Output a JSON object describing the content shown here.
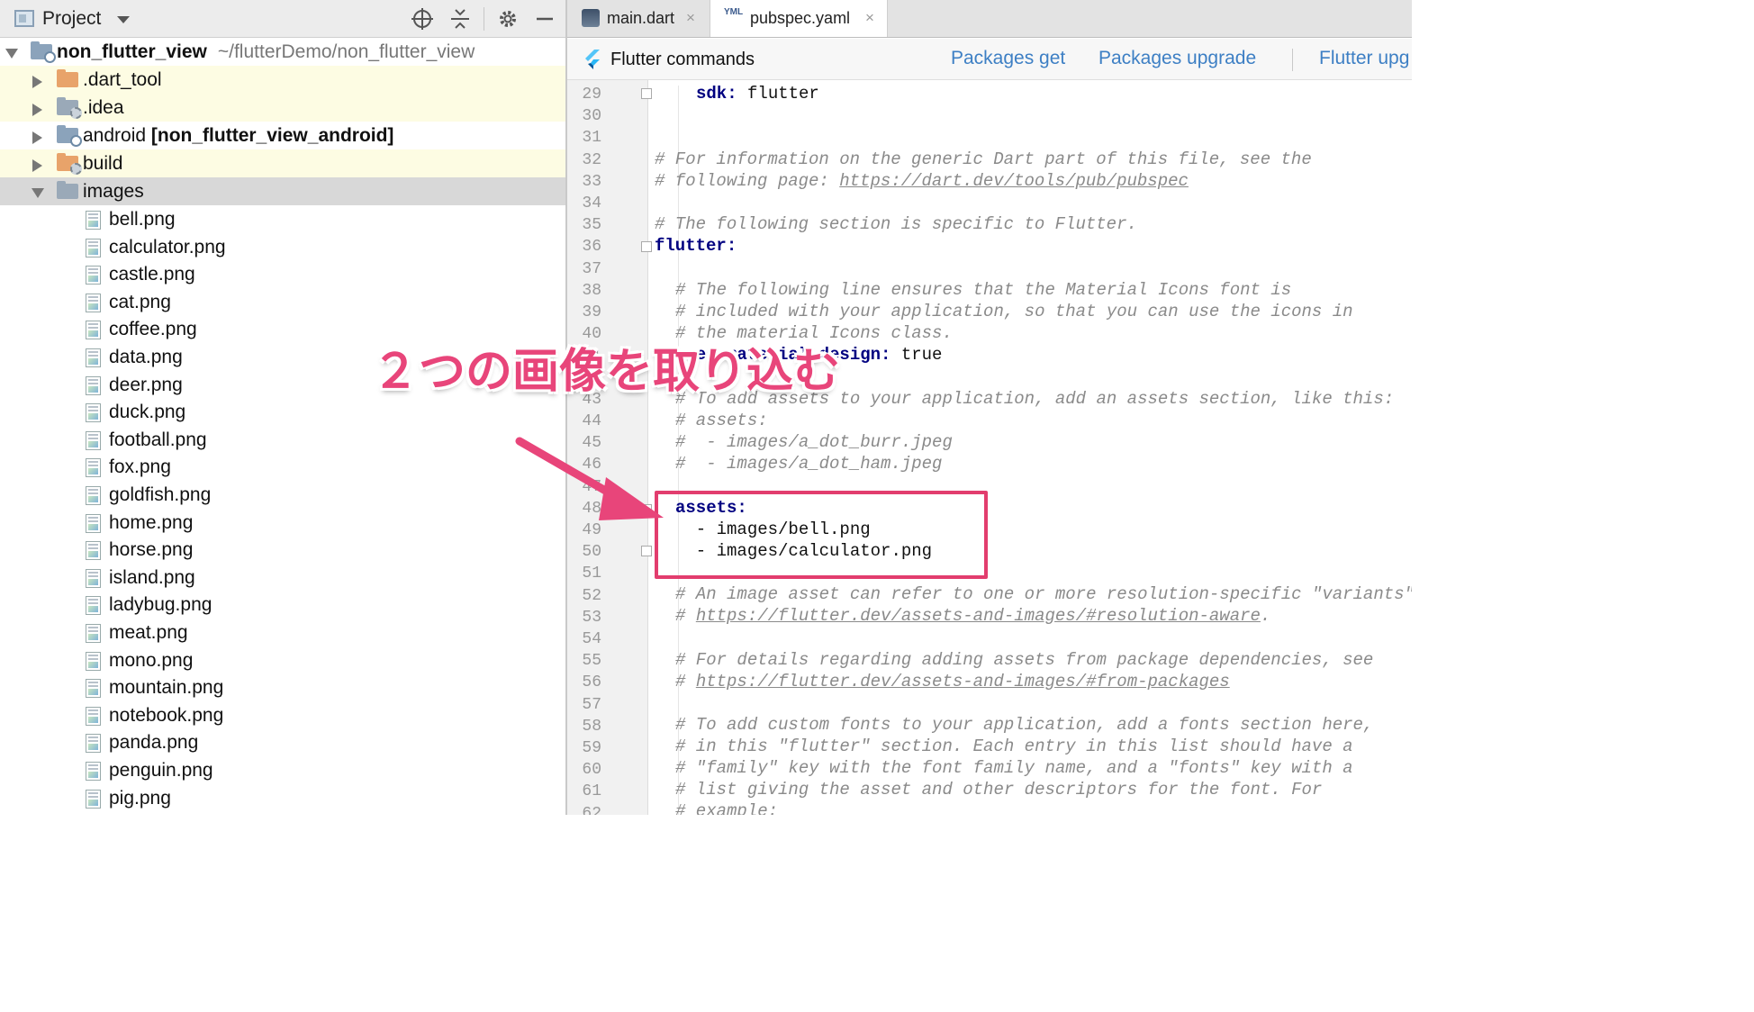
{
  "project_panel": {
    "title": "Project",
    "root": {
      "name": "non_flutter_view",
      "path": "~/flutterDemo/non_flutter_view"
    },
    "folders": [
      {
        "name": ".dart_tool",
        "bold_suffix": ""
      },
      {
        "name": ".idea",
        "bold_suffix": ""
      },
      {
        "name": "android",
        "bold_suffix": "[non_flutter_view_android]"
      },
      {
        "name": "build",
        "bold_suffix": ""
      },
      {
        "name": "images",
        "bold_suffix": ""
      }
    ],
    "files": [
      "bell.png",
      "calculator.png",
      "castle.png",
      "cat.png",
      "coffee.png",
      "data.png",
      "deer.png",
      "duck.png",
      "football.png",
      "fox.png",
      "goldfish.png",
      "home.png",
      "horse.png",
      "island.png",
      "ladybug.png",
      "meat.png",
      "mono.png",
      "mountain.png",
      "notebook.png",
      "panda.png",
      "penguin.png",
      "pig.png"
    ],
    "icons": [
      "crosshair-icon",
      "collapse-all-icon",
      "gear-icon",
      "minimize-icon"
    ]
  },
  "editor": {
    "tabs": [
      {
        "label": "main.dart",
        "active": false
      },
      {
        "label": "pubspec.yaml",
        "active": true
      }
    ],
    "tab_close": "×",
    "yml_badge": "YML",
    "flutter_commands": {
      "title": "Flutter commands",
      "actions": [
        "Packages get",
        "Packages upgrade",
        "Flutter upg"
      ]
    },
    "line_numbers": [
      "29",
      "30",
      "31",
      "32",
      "33",
      "34",
      "35",
      "36",
      "37",
      "38",
      "39",
      "40",
      "41",
      "42",
      "43",
      "44",
      "45",
      "46",
      "47",
      "48",
      "49",
      "50",
      "51",
      "52",
      "53",
      "54",
      "55",
      "56",
      "57",
      "58",
      "59",
      "60",
      "61",
      "62"
    ],
    "code": {
      "l29_key": "sdk:",
      "l29_val": " flutter",
      "l32": "# For information on the generic Dart part of this file, see the",
      "l33_pre": "# following page: ",
      "l33_link": "https://dart.dev/tools/pub/pubspec",
      "l35": "# The following section is specific to Flutter.",
      "l36_key": "flutter:",
      "l38": "# The following line ensures that the Material Icons font is",
      "l39": "# included with your application, so that you can use the icons in",
      "l40": "# the material Icons class.",
      "l41_key": "uses-material-design:",
      "l41_val": " true",
      "l43": "# To add assets to your application, add an assets section, like this:",
      "l44": "# assets:",
      "l45": "#  - images/a_dot_burr.jpeg",
      "l46": "#  - images/a_dot_ham.jpeg",
      "l48_key": "assets:",
      "l49": "  - images/bell.png",
      "l50": "  - images/calculator.png",
      "l52": "# An image asset can refer to one or more resolution-specific \"variants\",",
      "l53_pre": "# ",
      "l53_link": "https://flutter.dev/assets-and-images/#resolution-aware",
      "l53_post": ".",
      "l55": "# For details regarding adding assets from package dependencies, see",
      "l56_pre": "# ",
      "l56_link": "https://flutter.dev/assets-and-images/#from-packages",
      "l58": "# To add custom fonts to your application, add a fonts section here,",
      "l59": "# in this \"flutter\" section. Each entry in this list should have a",
      "l60": "# \"family\" key with the font family name, and a \"fonts\" key with a",
      "l61": "# list giving the asset and other descriptors for the font. For",
      "l62": "# example:"
    }
  },
  "annotation": {
    "text": "２つの画像を取り込む",
    "color": "#e8457a",
    "box_color": "#e23d6e"
  }
}
